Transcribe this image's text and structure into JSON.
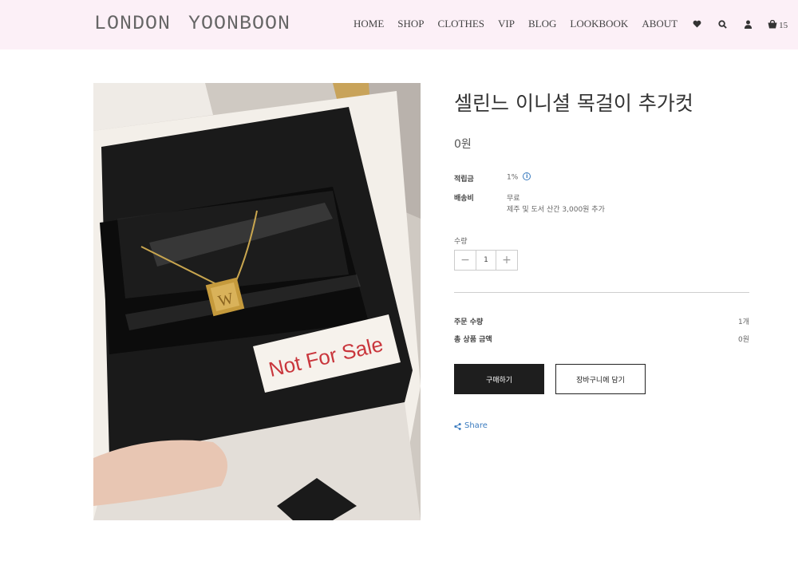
{
  "header": {
    "logo": "LONDON YOONBOON",
    "nav": [
      "HOME",
      "SHOP",
      "CLOTHES",
      "VIP",
      "BLOG",
      "LOOKBOOK",
      "ABOUT"
    ],
    "icons": [
      "heart-icon",
      "search-icon",
      "user-icon",
      "cart-icon"
    ],
    "cart_count": "15"
  },
  "product": {
    "image_text": "Not For Sale",
    "pendant_letter": "W",
    "title": "셀린느 이니셜 목걸이 추가컷",
    "price": "0원",
    "points_label": "적립금",
    "points_value": "1%",
    "shipping_label": "배송비",
    "shipping_value": "무료",
    "shipping_note": "제주 및 도서 산간 3,000원 추가",
    "quantity_label": "수량",
    "quantity_value": "1",
    "order_qty_label": "주문 수량",
    "order_qty_value": "1개",
    "total_label": "총 상품 금액",
    "total_value": "0원",
    "buy_label": "구매하기",
    "add_cart_label": "장바구니에 담기",
    "share_label": "Share"
  },
  "colors": {
    "header_bg": "#fcf0f7",
    "accent_link": "#3a7bbf",
    "buy_button": "#1e1e1e"
  }
}
